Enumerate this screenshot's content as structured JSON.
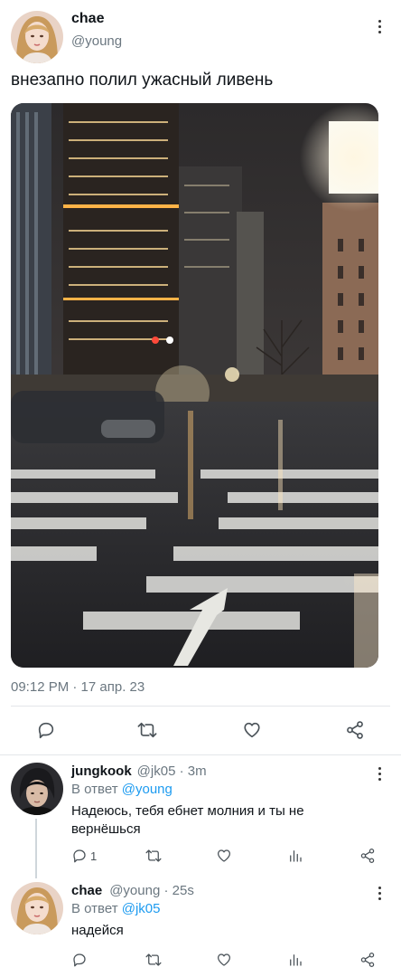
{
  "main_tweet": {
    "name": "chae",
    "handle": "@young",
    "text": "внезапно полил ужасный ливень",
    "timestamp": "09:12 PM · 17 апр. 23",
    "image_description_icon": "photo"
  },
  "replies": [
    {
      "name": "jungkook",
      "meta": "@jk05 · 3m",
      "reply_prefix": "В ответ ",
      "reply_mention": "@young",
      "text": "Надеюсь, тебя ебнет молния и ты не вернёшься",
      "reply_count": "1"
    },
    {
      "name": "chae",
      "meta": "@young · 25s",
      "reply_prefix": "В ответ ",
      "reply_mention": "@jk05",
      "text": "надейся",
      "reply_count": ""
    }
  ],
  "icons": {
    "reply": "reply-icon",
    "retweet": "retweet-icon",
    "like": "heart-icon",
    "share": "share-icon",
    "views": "views-icon",
    "more": "more-vertical-icon"
  },
  "colors": {
    "mention": "#1d9bf0",
    "muted": "#6b7780",
    "text": "#0f1419",
    "divider": "#e3e6e9"
  }
}
